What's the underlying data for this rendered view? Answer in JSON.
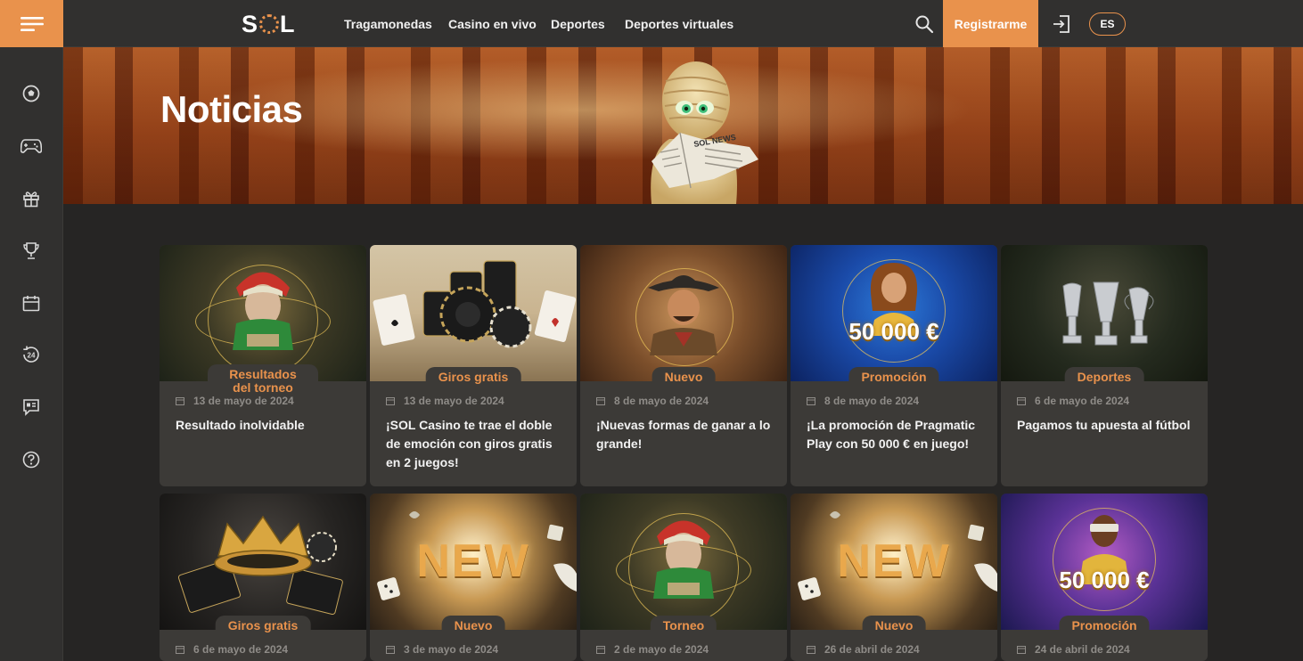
{
  "header": {
    "logo": "SL",
    "nav": [
      "Tragamonedas",
      "Casino en vivo",
      "Deportes",
      "Deportes virtuales"
    ],
    "register": "Registrarme",
    "lang": "ES"
  },
  "sidebar": {
    "icons": [
      "soccer-ball-icon",
      "gamepad-icon",
      "gift-icon",
      "trophy-icon",
      "calendar-icon",
      "support-24-icon",
      "chat-icon",
      "help-icon"
    ]
  },
  "hero": {
    "title": "Noticias",
    "newspaper_text": "SOL NEWS"
  },
  "cards": [
    {
      "tag": "Resultados del torneo",
      "date": "13 de mayo de 2024",
      "title": "Resultado inolvidable"
    },
    {
      "tag": "Giros gratis",
      "date": "13 de mayo de 2024",
      "title": "¡SOL Casino te trae el doble de emoción con giros gratis en 2 juegos!"
    },
    {
      "tag": "Nuevo",
      "date": "8 de mayo de 2024",
      "title": "¡Nuevas formas de ganar a lo grande!"
    },
    {
      "tag": "Promoción",
      "date": "8 de mayo de 2024",
      "title": "¡La promoción de Pragmatic Play con 50 000 € en juego!",
      "banner": "50 000 €"
    },
    {
      "tag": "Deportes",
      "date": "6 de mayo de 2024",
      "title": "Pagamos tu apuesta al fútbol"
    },
    {
      "tag": "Giros gratis",
      "date": "6 de mayo de 2024",
      "title": ""
    },
    {
      "tag": "Nuevo",
      "date": "3 de mayo de 2024",
      "title": "",
      "banner": "NEW"
    },
    {
      "tag": "Torneo",
      "date": "2 de mayo de 2024",
      "title": ""
    },
    {
      "tag": "Nuevo",
      "date": "26 de abril de 2024",
      "title": "",
      "banner": "NEW"
    },
    {
      "tag": "Promoción",
      "date": "24 de abril de 2024",
      "title": "",
      "banner": "50 000 €"
    }
  ]
}
